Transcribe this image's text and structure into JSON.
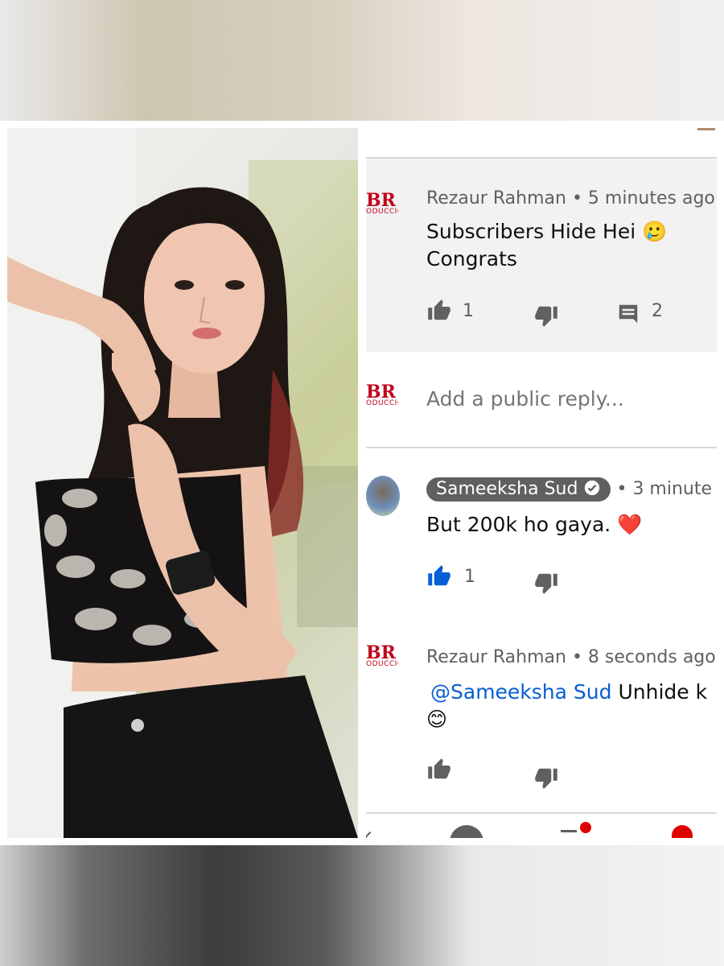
{
  "comments": [
    {
      "author": "Rezaur Rahman",
      "separator": "•",
      "time": "5 minutes ago",
      "text_line1": "Subscribers Hide Hei 🥲",
      "text_line2": "Congrats",
      "likes": "1",
      "replies": "2"
    },
    {
      "author": "Sameeksha Sud",
      "verified_icon": "check-circle-icon",
      "separator": "•",
      "time": "3 minute",
      "text": "But 200k ho gaya. ❤️",
      "likes": "1",
      "liked": true
    },
    {
      "author": "Rezaur Rahman",
      "separator": "•",
      "time": "8 seconds ago",
      "mention": "@Sameeksha Sud",
      "text_rest": "Unhide k",
      "emoji": "😊"
    }
  ],
  "reply_box": {
    "placeholder": "Add a public reply..."
  },
  "logo": {
    "letters": "BR",
    "sub": "ODUCCIO"
  },
  "colors": {
    "accent_blue": "#065fd4",
    "chip_gray": "#606060",
    "logo_red": "#c0001a"
  }
}
